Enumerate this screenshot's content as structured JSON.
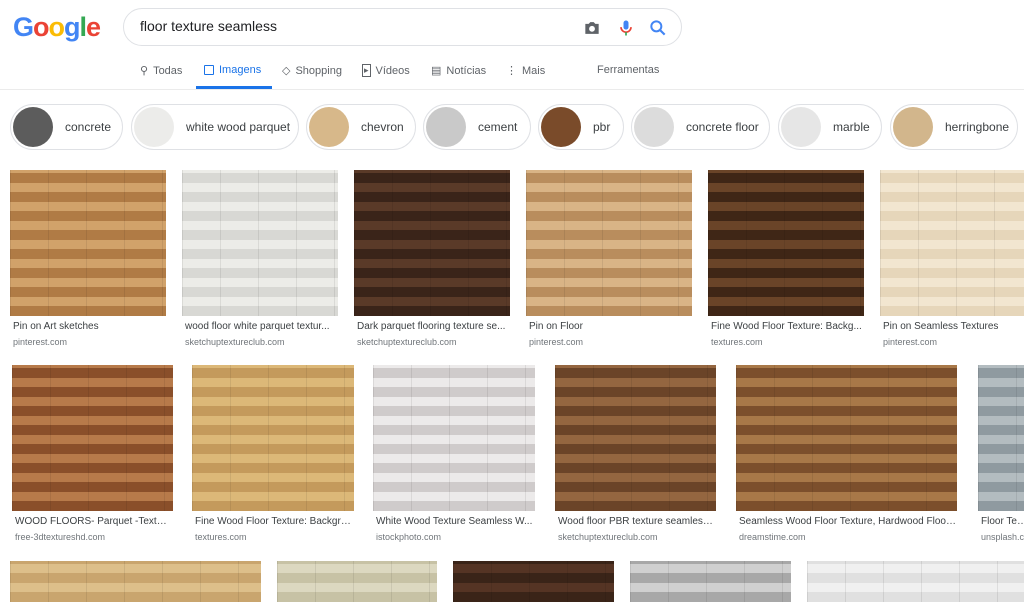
{
  "header": {
    "logo": "Google",
    "query": "floor texture seamless"
  },
  "tabs": [
    {
      "label": "Todas",
      "icon": "search-icon"
    },
    {
      "label": "Imagens",
      "icon": "image-icon",
      "active": true
    },
    {
      "label": "Shopping",
      "icon": "tag-icon"
    },
    {
      "label": "Vídeos",
      "icon": "play-icon"
    },
    {
      "label": "Notícias",
      "icon": "news-icon"
    },
    {
      "label": "Mais",
      "icon": "more-vert-icon"
    }
  ],
  "tools": "Ferramentas",
  "chips": [
    {
      "label": "concrete",
      "color": "#5c5c5c"
    },
    {
      "label": "white wood parquet",
      "color": "#ececea"
    },
    {
      "label": "chevron",
      "color": "#d7b88a"
    },
    {
      "label": "cement",
      "color": "#c9c9c9"
    },
    {
      "label": "pbr",
      "color": "#7a4b2a"
    },
    {
      "label": "concrete floor",
      "color": "#dcdcdc"
    },
    {
      "label": "marble",
      "color": "#e6e6e6"
    },
    {
      "label": "herringbone",
      "color": "#d2b68c"
    }
  ],
  "results": [
    {
      "title": "Pin on Art sketches",
      "source": "pinterest.com",
      "c1": "#b07b45",
      "c2": "#d1a26a"
    },
    {
      "title": "wood floor white parquet textur...",
      "source": "sketchuptextureclub.com",
      "c1": "#d8d8d4",
      "c2": "#ecece8"
    },
    {
      "title": "Dark parquet flooring texture se...",
      "source": "sketchuptextureclub.com",
      "c1": "#3a2419",
      "c2": "#5a3a28"
    },
    {
      "title": "Pin on Floor",
      "source": "pinterest.com",
      "c1": "#b98d5d",
      "c2": "#d9b486"
    },
    {
      "title": "Fine Wood Floor Texture: Backg...",
      "source": "textures.com",
      "c1": "#3f2616",
      "c2": "#6a4428"
    },
    {
      "title": "Pin on Seamless Textures",
      "source": "pinterest.com",
      "c1": "#e6d6ba",
      "c2": "#f2e6d0"
    },
    {
      "title": "WOOD FLOORS- Parquet -Textures...",
      "source": "free-3dtextureshd.com",
      "c1": "#8a4f2a",
      "c2": "#b77a4a"
    },
    {
      "title": "Fine Wood Floor Texture: Backgro...",
      "source": "textures.com",
      "c1": "#c49a5c",
      "c2": "#dcb878"
    },
    {
      "title": "White Wood Texture Seamless W...",
      "source": "istockphoto.com",
      "c1": "#cfcbcb",
      "c2": "#eceaea"
    },
    {
      "title": "Wood floor PBR texture seamless ...",
      "source": "sketchuptextureclub.com",
      "c1": "#6b4428",
      "c2": "#946640"
    },
    {
      "title": "Seamless Wood Floor Texture, Hardwood Floor ...",
      "source": "dreamstime.com",
      "c1": "#7c4f2c",
      "c2": "#a87848"
    },
    {
      "title": "Floor Texture",
      "source": "unsplash.com",
      "c1": "#8f9aa0",
      "c2": "#b3bcc0"
    },
    {
      "c1": "#c9a56e",
      "c2": "#ddbf8a"
    },
    {
      "c1": "#c7c2a5",
      "c2": "#dcd8c0"
    },
    {
      "c1": "#3a2418",
      "c2": "#553424"
    },
    {
      "c1": "#a8a8a8",
      "c2": "#d0d0d0"
    },
    {
      "c1": "#e0e0e0",
      "c2": "#f0f0f0"
    }
  ]
}
